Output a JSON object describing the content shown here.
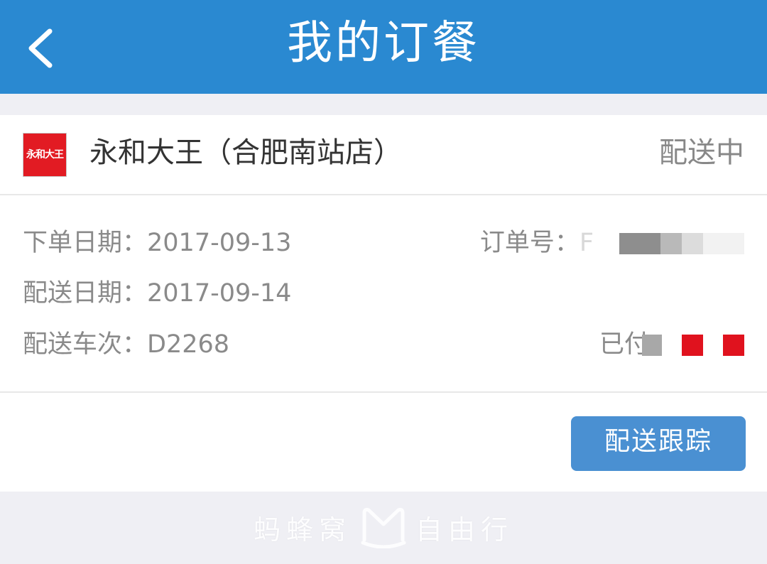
{
  "header": {
    "title": "我的订餐",
    "back_icon": "chevron-left-icon",
    "bg_color": "#2a89d1"
  },
  "store": {
    "logo_text": "永和大王",
    "logo_color": "#e21b23",
    "name": "永和大王（合肥南站店）",
    "status": "配送中"
  },
  "order": {
    "order_date_label": "下单日期：",
    "order_date": "2017-09-13",
    "delivery_date_label": "配送日期：",
    "delivery_date": "2017-09-14",
    "train_label": "配送车次：",
    "train_no": "D2268",
    "order_no_label": "订单号：",
    "order_no_visible": "F",
    "paid_label": "已付"
  },
  "actions": {
    "track_label": "配送跟踪",
    "track_color": "#4a90d2"
  },
  "watermark": {
    "left_text": "蚂蜂窝",
    "right_text": "自由行",
    "logo_icon": "mafengwo-m-icon"
  }
}
